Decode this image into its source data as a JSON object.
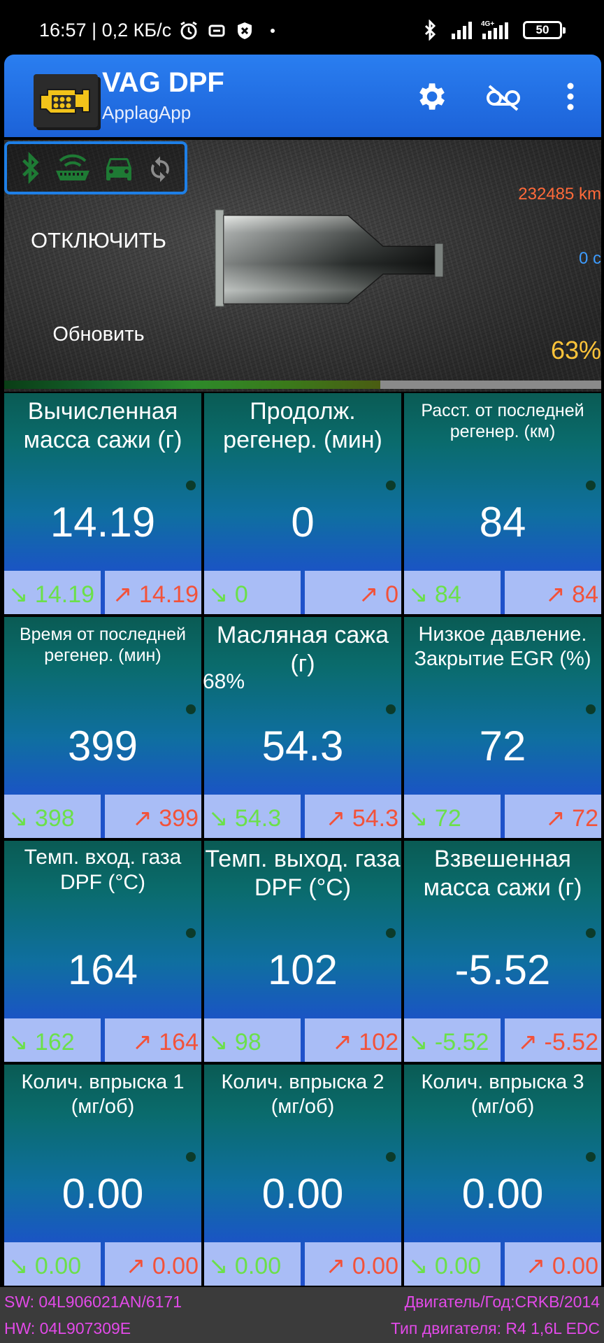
{
  "status_bar": {
    "time_speed": "16:57 | 0,2 КБ/с",
    "network_type": "4G+",
    "battery": "50",
    "icons": [
      "alarm-icon",
      "sync-icon",
      "shield-icon",
      "dot-icon",
      "bluetooth-icon",
      "signal-icon",
      "signal-4g-icon",
      "battery-icon"
    ]
  },
  "app_bar": {
    "title": "VAG DPF",
    "subtitle": "ApplagApp",
    "icons": [
      "engine-logo-icon",
      "settings-icon",
      "record-off-icon",
      "more-vert-icon"
    ]
  },
  "hero": {
    "disconnect_label": "ОТКЛЮЧИТЬ",
    "refresh_label": "Обновить",
    "odometer": "232485 km",
    "regen_time": "0 с",
    "soot_percent": "63%",
    "load_fraction": 0.63,
    "status_icons": [
      "bluetooth-icon",
      "obd-adapter-icon",
      "car-icon",
      "refresh-icon"
    ],
    "status_color": "#1e7a34"
  },
  "tiles": [
    {
      "title": "Вычисленная масса сажи (г)",
      "value": "14.19",
      "min": "↘ 14.19",
      "max": "↗ 14.19"
    },
    {
      "title": "Продолж. регенер. (мин)",
      "value": "0",
      "min": "↘ 0",
      "max": "↗ 0"
    },
    {
      "title": "Расст. от последней регенер. (км)",
      "value": "84",
      "min": "↘ 84",
      "max": "↗ 84"
    },
    {
      "title": "Время от последней регенер. (мин)",
      "value": "399",
      "min": "↘ 398",
      "max": "↗ 399"
    },
    {
      "title": "Масляная сажа (г)",
      "value": "54.3",
      "min": "↘ 54.3",
      "max": "↗ 54.3"
    },
    {
      "title": "Низкое давление. Закрытие EGR (%)",
      "value": "72",
      "min": "↘ 72",
      "max": "↗ 72"
    },
    {
      "title": "Темп. вход. газа DPF (°C)",
      "value": "164",
      "min": "↘ 162",
      "max": "↗ 164"
    },
    {
      "title": "Темп. выход. газа DPF (°C)",
      "value": "102",
      "min": "↘ 98",
      "max": "↗ 102"
    },
    {
      "title": "Взвешенная масса сажи (г)",
      "value": "-5.52",
      "min": "↘ -5.52",
      "max": "↗ -5.52"
    },
    {
      "title": "Колич. впрыска 1 (мг/об)",
      "value": "0.00",
      "min": "↘ 0.00",
      "max": "↗ 0.00"
    },
    {
      "title": "Колич. впрыска 2 (мг/об)",
      "value": "0.00",
      "min": "↘ 0.00",
      "max": "↗ 0.00"
    },
    {
      "title": "Колич. впрыска 3 (мг/об)",
      "value": "0.00",
      "min": "↘ 0.00",
      "max": "↗ 0.00"
    }
  ],
  "overlay_percent": "68%",
  "footer": {
    "sw": "SW: 04L906021AN/6171",
    "hw": "HW: 04L907309E",
    "engine_year": "Двигатель/Год:CRKB/2014",
    "engine_type": "Тип двигателя: R4 1,6L EDC"
  },
  "colors": {
    "accent": "#1e6fe0",
    "min_value": "#6be04a",
    "max_value": "#f2523a",
    "odometer": "#ff6a3a",
    "regen_time": "#3d9cff",
    "percent": "#ffc43a",
    "footer_text": "#e24ae8"
  }
}
